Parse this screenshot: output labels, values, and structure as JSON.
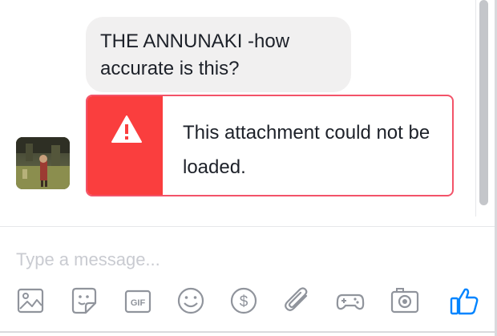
{
  "conversation": {
    "message": {
      "text": "THE ANNUNAKI -how accurate is this?"
    },
    "attachment_error": {
      "text": "This attachment could not be loaded.",
      "icon": "warning-icon"
    },
    "sender_avatar": {
      "icon": "avatar"
    }
  },
  "composer": {
    "placeholder": "Type a message...",
    "toolbar": [
      {
        "name": "photo-icon"
      },
      {
        "name": "sticker-icon"
      },
      {
        "name": "gif-icon",
        "label": "GIF"
      },
      {
        "name": "emoji-icon"
      },
      {
        "name": "payment-icon",
        "label": "$"
      },
      {
        "name": "attachment-icon"
      },
      {
        "name": "game-icon"
      },
      {
        "name": "camera-icon"
      },
      {
        "name": "like-icon"
      }
    ]
  },
  "colors": {
    "error_red": "#fa3e3e",
    "error_border": "#f35369",
    "bubble_gray": "#f1f0f0",
    "icon_gray": "#90949c",
    "like_blue": "#0084ff"
  }
}
